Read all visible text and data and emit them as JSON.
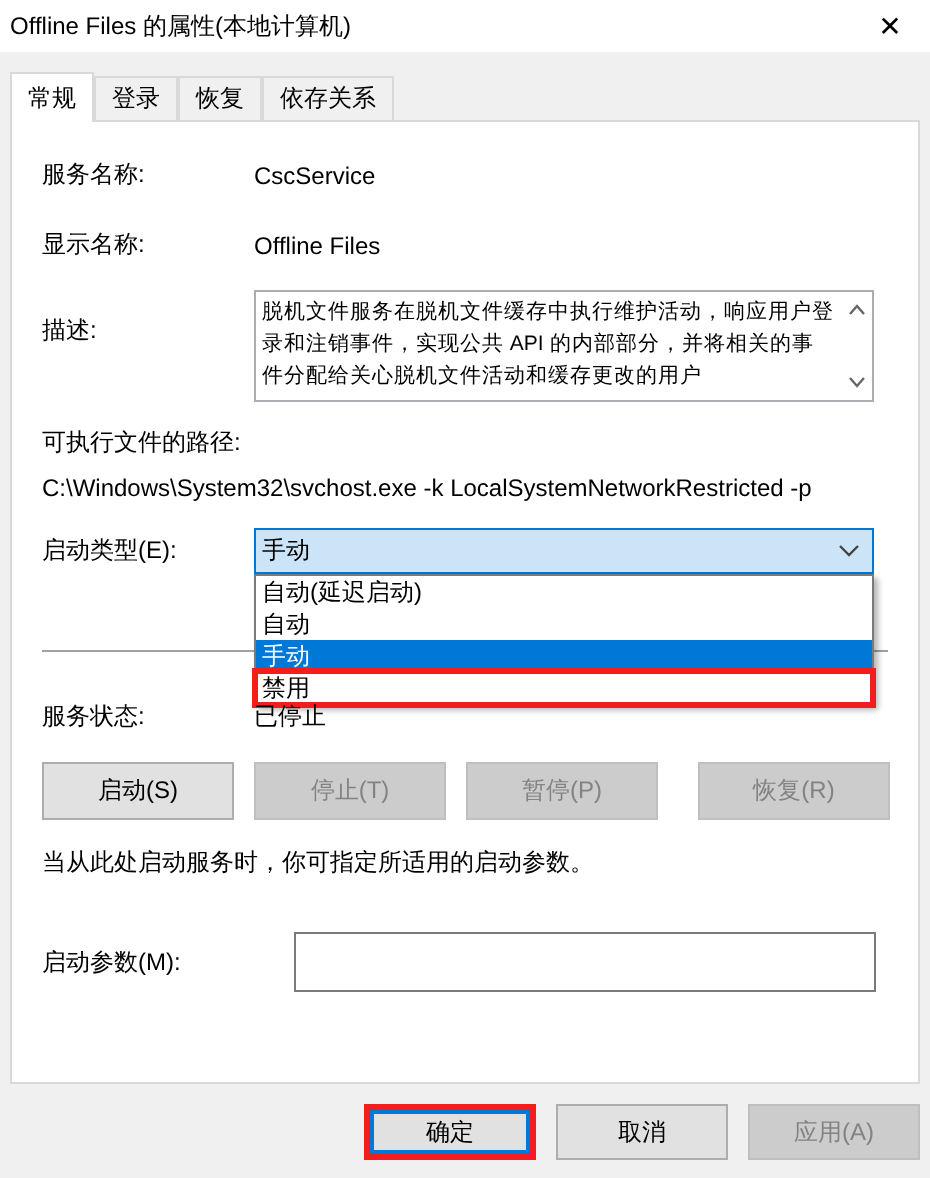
{
  "window": {
    "title": "Offline Files 的属性(本地计算机)",
    "close": "✕"
  },
  "tabs": [
    {
      "label": "常规",
      "selected": true
    },
    {
      "label": "登录",
      "selected": false
    },
    {
      "label": "恢复",
      "selected": false
    },
    {
      "label": "依存关系",
      "selected": false
    }
  ],
  "service_name": {
    "label": "服务名称:",
    "value": "CscService"
  },
  "display_name": {
    "label": "显示名称:",
    "value": "Offline Files"
  },
  "description": {
    "label": "描述:",
    "value": "脱机文件服务在脱机文件缓存中执行维护活动，响应用户登录和注销事件，实现公共 API 的内部部分，并将相关的事件分配给关心脱机文件活动和缓存更改的用户"
  },
  "executable_path": {
    "label": "可执行文件的路径:",
    "value": "C:\\Windows\\System32\\svchost.exe -k LocalSystemNetworkRestricted -p"
  },
  "startup_type": {
    "label": "启动类型(E):",
    "value": "手动",
    "expanded": true,
    "options": [
      {
        "label": "自动(延迟启动)",
        "selected": false,
        "highlighted": false
      },
      {
        "label": "自动",
        "selected": false,
        "highlighted": false
      },
      {
        "label": "手动",
        "selected": true,
        "highlighted": false
      },
      {
        "label": "禁用",
        "selected": false,
        "highlighted": true
      }
    ]
  },
  "service_status": {
    "label": "服务状态:",
    "value": "已停止"
  },
  "service_buttons": [
    {
      "label": "启动(S)",
      "disabled": false
    },
    {
      "label": "停止(T)",
      "disabled": true
    },
    {
      "label": "暂停(P)",
      "disabled": true
    },
    {
      "label": "恢复(R)",
      "disabled": true
    }
  ],
  "hint": "当从此处启动服务时，你可指定所适用的启动参数。",
  "start_parameters": {
    "label": "启动参数(M):"
  },
  "dialog_buttons": [
    {
      "label": "确定",
      "default": true,
      "highlighted": true,
      "disabled": false
    },
    {
      "label": "取消",
      "default": false,
      "highlighted": false,
      "disabled": false
    },
    {
      "label": "应用(A)",
      "default": false,
      "highlighted": false,
      "disabled": true
    }
  ]
}
